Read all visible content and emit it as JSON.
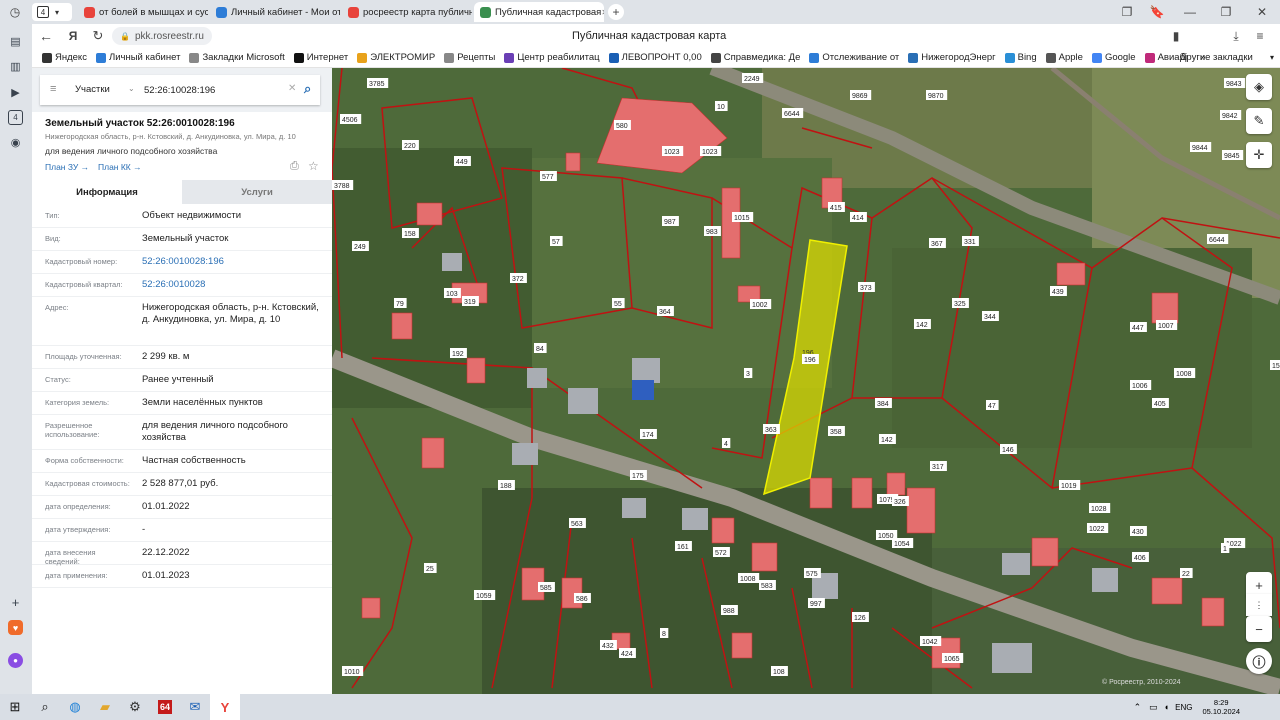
{
  "browser": {
    "tabs": [
      {
        "label": "от болей в мышцах и сус",
        "color": "#e8433b"
      },
      {
        "label": "Личный кабинет - Мои от",
        "color": "#2e7dd7"
      },
      {
        "label": "росреестр карта публичн",
        "color": "#e8433b"
      },
      {
        "label": "Публичная кадастровая",
        "color": "#3a8f4f",
        "active": true
      }
    ],
    "tab_count": "4",
    "address": "pkk.rosreestr.ru",
    "page_title": "Публичная кадастровая карта",
    "bookmarks": [
      "Яндекс",
      "Личный кабинет",
      "Закладки Microsoft",
      "Интернет",
      "ЭЛЕКТРОМИР",
      "Рецепты",
      "Центр реабилитац",
      "ЛЕВОПРОНТ 0,00",
      "Справмедика: Де",
      "Отслеживание от",
      "НижегородЭнерг",
      "Bing",
      "Apple",
      "Google",
      "Авиабі"
    ],
    "other_bookmarks": "Другие закладки"
  },
  "search": {
    "category": "Участки",
    "query": "52:26:10028:196"
  },
  "parcel": {
    "title": "Земельный участок 52:26:0010028:196",
    "subtitle": "Нижегородская область, р-н. Кстовский, д. Анкудиновка, ул. Мира, д. 10",
    "purpose": "для ведения личного подсобного хозяйства",
    "plan_zu": "План ЗУ →",
    "plan_kk": "План КК →",
    "tabs": {
      "info": "Информация",
      "services": "Услуги"
    },
    "rows": [
      {
        "label": "Тип:",
        "value": "Объект недвижимости"
      },
      {
        "label": "Вид:",
        "value": "Земельный участок"
      },
      {
        "label": "Кадастровый номер:",
        "value": "52:26:0010028:196",
        "link": true
      },
      {
        "label": "Кадастровый квартал:",
        "value": "52:26:0010028",
        "link": true
      },
      {
        "label": "Адрес:",
        "value": "Нижегородская область, р-н. Кстовский, д. Анкудиновка, ул. Мира, д. 10"
      },
      {
        "label": "Площадь уточненная:",
        "value": "2 299 кв. м"
      },
      {
        "label": "Статус:",
        "value": "Ранее учтенный"
      },
      {
        "label": "Категория земель:",
        "value": "Земли населённых пунктов"
      },
      {
        "label": "Разрешенное использование:",
        "value": "для ведения личного подсобного хозяйства"
      },
      {
        "label": "Форма собственности:",
        "value": "Частная собственность"
      },
      {
        "label": "Кадастровая стоимость:",
        "value": "2 528 877,01 руб."
      },
      {
        "label": "дата определения:",
        "value": "01.01.2022"
      },
      {
        "label": "дата утверждения:",
        "value": "-"
      },
      {
        "label": "дата внесения сведений:",
        "value": "22.12.2022"
      },
      {
        "label": "дата применения:",
        "value": "01.01.2023"
      }
    ]
  },
  "map": {
    "parcel_labels": [
      "3785",
      "4506",
      "3788",
      "249",
      "220",
      "449",
      "577",
      "580",
      "1023",
      "1023",
      "10",
      "2249",
      "9869",
      "9870",
      "9843",
      "9842",
      "9844",
      "9845",
      "6644",
      "6644",
      "158",
      "79",
      "103",
      "319",
      "192",
      "372",
      "57",
      "55",
      "84",
      "364",
      "987",
      "983",
      "1015",
      "415",
      "414",
      "373",
      "367",
      "331",
      "439",
      "1007",
      "447",
      "1006",
      "1008",
      "405",
      "325",
      "344",
      "142",
      "1002",
      "196",
      "3",
      "384",
      "174",
      "4",
      "363",
      "358",
      "142",
      "317",
      "146",
      "47",
      "1022",
      "1028",
      "1019",
      "188",
      "175",
      "563",
      "161",
      "572",
      "583",
      "575",
      "1008",
      "997",
      "988",
      "8",
      "126",
      "108",
      "432",
      "424",
      "585",
      "586",
      "1010",
      "25",
      "1059",
      "1042",
      "1065",
      "1079",
      "326",
      "1054",
      "1050",
      "430",
      "406",
      "22",
      "1022",
      "1",
      "150"
    ],
    "selected_label": "196",
    "copyright": "© Росреестр, 2010-2024"
  },
  "taskbar": {
    "time": "8:29",
    "date": "05.10.2024",
    "lang": "ENG",
    "badge": "64"
  }
}
